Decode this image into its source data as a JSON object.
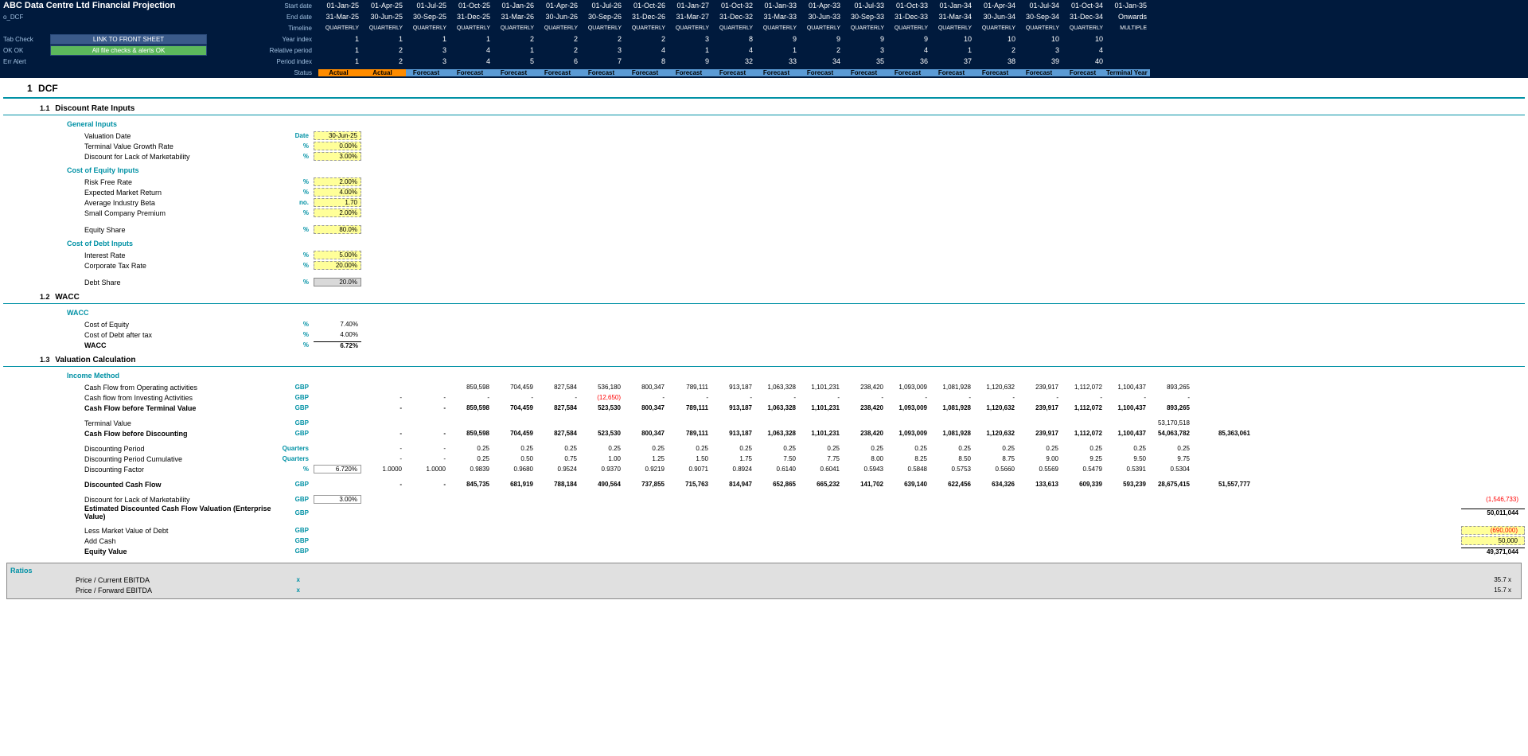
{
  "hdr": {
    "title": "ABC Data Centre Ltd Financial Projection",
    "sheet": "o_DCF",
    "link": "LINK TO FRONT SHEET",
    "checks": "All file checks & alerts OK",
    "tab": "Tab Check",
    "ok": "OK",
    "ok2": "OK",
    "err": "Err",
    "alert": "Alert",
    "rows": [
      {
        "lbl": "Start date",
        "v": [
          "01-Jan-25",
          "01-Apr-25",
          "01-Jul-25",
          "01-Oct-25",
          "01-Jan-26",
          "01-Apr-26",
          "01-Jul-26",
          "01-Oct-26",
          "01-Jan-27",
          "01-Oct-32",
          "01-Jan-33",
          "01-Apr-33",
          "01-Jul-33",
          "01-Oct-33",
          "01-Jan-34",
          "01-Apr-34",
          "01-Jul-34",
          "01-Oct-34",
          "01-Jan-35"
        ]
      },
      {
        "lbl": "End date",
        "v": [
          "31-Mar-25",
          "30-Jun-25",
          "30-Sep-25",
          "31-Dec-25",
          "31-Mar-26",
          "30-Jun-26",
          "30-Sep-26",
          "31-Dec-26",
          "31-Mar-27",
          "31-Dec-32",
          "31-Mar-33",
          "30-Jun-33",
          "30-Sep-33",
          "31-Dec-33",
          "31-Mar-34",
          "30-Jun-34",
          "30-Sep-34",
          "31-Dec-34",
          "Onwards"
        ]
      },
      {
        "lbl": "Timeline",
        "v": [
          "QUARTERLY",
          "QUARTERLY",
          "QUARTERLY",
          "QUARTERLY",
          "QUARTERLY",
          "QUARTERLY",
          "QUARTERLY",
          "QUARTERLY",
          "QUARTERLY",
          "QUARTERLY",
          "QUARTERLY",
          "QUARTERLY",
          "QUARTERLY",
          "QUARTERLY",
          "QUARTERLY",
          "QUARTERLY",
          "QUARTERLY",
          "QUARTERLY",
          "MULTIPLE"
        ]
      },
      {
        "lbl": "Year index",
        "v": [
          "1",
          "1",
          "1",
          "1",
          "2",
          "2",
          "2",
          "2",
          "3",
          "8",
          "9",
          "9",
          "9",
          "9",
          "10",
          "10",
          "10",
          "10",
          ""
        ]
      },
      {
        "lbl": "Relative period",
        "v": [
          "1",
          "2",
          "3",
          "4",
          "1",
          "2",
          "3",
          "4",
          "1",
          "4",
          "1",
          "2",
          "3",
          "4",
          "1",
          "2",
          "3",
          "4",
          ""
        ]
      },
      {
        "lbl": "Period index",
        "v": [
          "1",
          "2",
          "3",
          "4",
          "5",
          "6",
          "7",
          "8",
          "9",
          "32",
          "33",
          "34",
          "35",
          "36",
          "37",
          "38",
          "39",
          "40",
          ""
        ]
      },
      {
        "lbl": "Status",
        "v": [
          "Actual",
          "Actual",
          "Forecast",
          "Forecast",
          "Forecast",
          "Forecast",
          "Forecast",
          "Forecast",
          "Forecast",
          "Forecast",
          "Forecast",
          "Forecast",
          "Forecast",
          "Forecast",
          "Forecast",
          "Forecast",
          "Forecast",
          "Forecast",
          "Terminal Year"
        ]
      }
    ]
  },
  "s1": {
    "num": "1",
    "title": "DCF"
  },
  "s11": {
    "num": "1.1",
    "title": "Discount Rate Inputs"
  },
  "gi": {
    "h": "General Inputs",
    "rows": [
      {
        "t": "Valuation Date",
        "u": "Date",
        "v": "30-Jun-25"
      },
      {
        "t": "Terminal Value Growth Rate",
        "u": "%",
        "v": "0.00%"
      },
      {
        "t": "Discount for Lack of Marketability",
        "u": "%",
        "v": "3.00%"
      }
    ]
  },
  "ce": {
    "h": "Cost of Equity Inputs",
    "rows": [
      {
        "t": "Risk Free Rate",
        "u": "%",
        "v": "2.00%"
      },
      {
        "t": "Expected Market Return",
        "u": "%",
        "v": "4.00%"
      },
      {
        "t": "Average Industry Beta",
        "u": "no.",
        "v": "1.70"
      },
      {
        "t": "Small Company Premium",
        "u": "%",
        "v": "2.00%"
      }
    ],
    "eq": {
      "t": "Equity Share",
      "u": "%",
      "v": "80.0%"
    }
  },
  "cd": {
    "h": "Cost of Debt Inputs",
    "rows": [
      {
        "t": "Interest Rate",
        "u": "%",
        "v": "5.00%"
      },
      {
        "t": "Corporate Tax Rate",
        "u": "%",
        "v": "20.00%"
      }
    ],
    "ds": {
      "t": "Debt Share",
      "u": "%",
      "v": "20.0%"
    }
  },
  "s12": {
    "num": "1.2",
    "title": "WACC"
  },
  "wacc": {
    "h": "WACC",
    "rows": [
      {
        "t": "Cost of Equity",
        "u": "%",
        "v": "7.40%"
      },
      {
        "t": "Cost of Debt after tax",
        "u": "%",
        "v": "4.00%"
      },
      {
        "t": "WACC",
        "u": "%",
        "v": "6.72%",
        "bold": true
      }
    ]
  },
  "s13": {
    "num": "1.3",
    "title": "Valuation Calculation"
  },
  "im": {
    "h": "Income Method",
    "cfo": {
      "t": "Cash Flow from Operating activities",
      "u": "GBP",
      "v": [
        "",
        "",
        "859,598",
        "704,459",
        "827,584",
        "536,180",
        "800,347",
        "789,111",
        "913,187",
        "1,063,328",
        "1,101,231",
        "238,420",
        "1,093,009",
        "1,081,928",
        "1,120,632",
        "239,917",
        "1,112,072",
        "1,100,437",
        "893,265"
      ]
    },
    "cfi": {
      "t": "Cash flow from Investing Activities",
      "u": "GBP",
      "v": [
        "-",
        "-",
        "-",
        "-",
        "-",
        "(12,650)",
        "-",
        "-",
        "-",
        "-",
        "-",
        "-",
        "-",
        "-",
        "-",
        "-",
        "-",
        "-",
        "-"
      ],
      "neg": [
        5
      ]
    },
    "cfbt": {
      "t": "Cash Flow before Terminal Value",
      "u": "GBP",
      "v": [
        "-",
        "-",
        "859,598",
        "704,459",
        "827,584",
        "523,530",
        "800,347",
        "789,111",
        "913,187",
        "1,063,328",
        "1,101,231",
        "238,420",
        "1,093,009",
        "1,081,928",
        "1,120,632",
        "239,917",
        "1,112,072",
        "1,100,437",
        "893,265"
      ],
      "bold": true
    },
    "tv": {
      "t": "Terminal Value",
      "u": "GBP",
      "v": [
        "",
        "",
        "",
        "",
        "",
        "",
        "",
        "",
        "",
        "",
        "",
        "",
        "",
        "",
        "",
        "",
        "",
        "",
        "53,170,518"
      ]
    },
    "cfbd": {
      "t": "Cash Flow before Discounting",
      "u": "GBP",
      "v": [
        "-",
        "-",
        "859,598",
        "704,459",
        "827,584",
        "523,530",
        "800,347",
        "789,111",
        "913,187",
        "1,063,328",
        "1,101,231",
        "238,420",
        "1,093,009",
        "1,081,928",
        "1,120,632",
        "239,917",
        "1,112,072",
        "1,100,437",
        "54,063,782"
      ],
      "bold": true,
      "tot": "85,363,061"
    },
    "dp": {
      "t": "Discounting Period",
      "u": "Quarters",
      "v": [
        "-",
        "-",
        "0.25",
        "0.25",
        "0.25",
        "0.25",
        "0.25",
        "0.25",
        "0.25",
        "0.25",
        "0.25",
        "0.25",
        "0.25",
        "0.25",
        "0.25",
        "0.25",
        "0.25",
        "0.25",
        "0.25"
      ]
    },
    "dpc": {
      "t": "Discounting Period Cumulative",
      "u": "Quarters",
      "v": [
        "-",
        "-",
        "0.25",
        "0.50",
        "0.75",
        "1.00",
        "1.25",
        "1.50",
        "1.75",
        "7.50",
        "7.75",
        "8.00",
        "8.25",
        "8.50",
        "8.75",
        "9.00",
        "9.25",
        "9.50",
        "9.75"
      ]
    },
    "df": {
      "t": "Discounting Factor",
      "u": "%",
      "inp": "6.720%",
      "v": [
        "1.0000",
        "1.0000",
        "0.9839",
        "0.9680",
        "0.9524",
        "0.9370",
        "0.9219",
        "0.9071",
        "0.8924",
        "0.6140",
        "0.6041",
        "0.5943",
        "0.5848",
        "0.5753",
        "0.5660",
        "0.5569",
        "0.5479",
        "0.5391",
        "0.5304"
      ]
    },
    "dcf": {
      "t": "Discounted Cash Flow",
      "u": "GBP",
      "v": [
        "-",
        "-",
        "845,735",
        "681,919",
        "788,184",
        "490,564",
        "737,855",
        "715,763",
        "814,947",
        "652,865",
        "665,232",
        "141,702",
        "639,140",
        "622,456",
        "634,326",
        "133,613",
        "609,339",
        "593,239",
        "28,675,415"
      ],
      "bold": true,
      "tot": "51,557,777"
    },
    "dlm": {
      "t": "Discount for Lack of Marketability",
      "u": "GBP",
      "inp": "3.00%",
      "tot": "(1,546,733)",
      "neg": true
    },
    "edcf": {
      "t": "Estimated Discounted Cash Flow Valuation (Enterprise Value)",
      "u": "GBP",
      "tot": "50,011,044",
      "bold": true
    },
    "lmvd": {
      "t": "Less Market Value of Debt",
      "u": "GBP",
      "tot": "(690,000)",
      "neg": true,
      "yel": true
    },
    "ac": {
      "t": "Add Cash",
      "u": "GBP",
      "tot": "50,000",
      "yel": true
    },
    "ev": {
      "t": "Equity Value",
      "u": "GBP",
      "tot": "49,371,044",
      "bold": true
    }
  },
  "ratios": {
    "h": "Ratios",
    "r1": {
      "t": "Price / Current EBITDA",
      "u": "x",
      "v": "35.7 x"
    },
    "r2": {
      "t": "Price / Forward EBITDA",
      "u": "x",
      "v": "15.7 x"
    }
  }
}
